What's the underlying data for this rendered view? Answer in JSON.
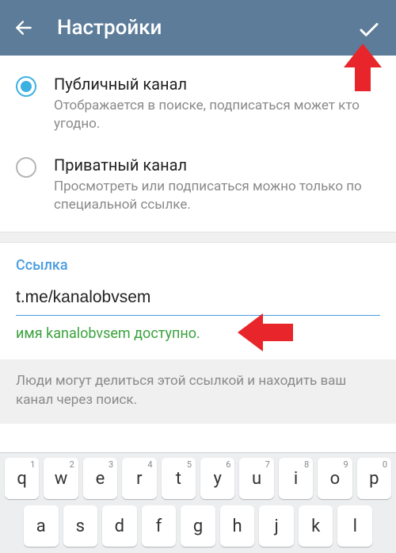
{
  "header": {
    "title": "Настройки"
  },
  "channel_type": {
    "public": {
      "label": "Публичный канал",
      "desc": "Отображается в поиске, подписаться может кто угодно."
    },
    "private": {
      "label": "Приватный канал",
      "desc": "Просмотреть или подписаться можно только по специальной ссылке."
    }
  },
  "link": {
    "section_title": "Ссылка",
    "value": "t.me/kanalobvsem",
    "status": "имя kanalobvsem доступно."
  },
  "help": {
    "text": "Люди могут делиться этой ссылкой и находить ваш канал через поиск."
  },
  "keyboard": {
    "row1": [
      {
        "ch": "q",
        "n": "1"
      },
      {
        "ch": "w",
        "n": "2"
      },
      {
        "ch": "e",
        "n": "3"
      },
      {
        "ch": "r",
        "n": "4"
      },
      {
        "ch": "t",
        "n": "5"
      },
      {
        "ch": "y",
        "n": "6"
      },
      {
        "ch": "u",
        "n": "7"
      },
      {
        "ch": "i",
        "n": "8"
      },
      {
        "ch": "o",
        "n": "9"
      },
      {
        "ch": "p",
        "n": "0"
      }
    ],
    "row2": [
      {
        "ch": "a"
      },
      {
        "ch": "s"
      },
      {
        "ch": "d"
      },
      {
        "ch": "f"
      },
      {
        "ch": "g"
      },
      {
        "ch": "h"
      },
      {
        "ch": "j"
      },
      {
        "ch": "k"
      },
      {
        "ch": "l"
      }
    ]
  }
}
